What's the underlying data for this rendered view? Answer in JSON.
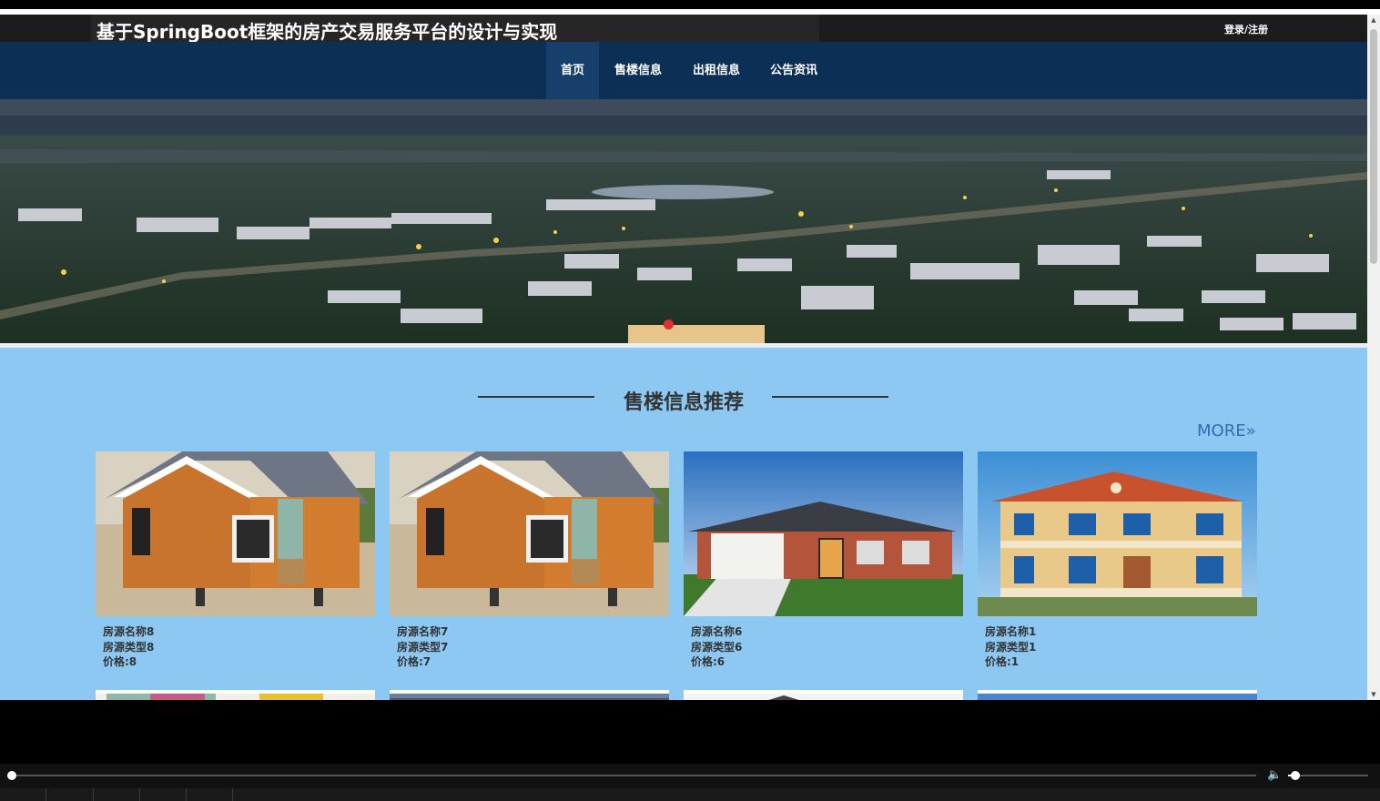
{
  "header": {
    "site_title": "基于SpringBoot框架的房产交易服务平台的设计与实现",
    "login_label": "登录/注册"
  },
  "nav": {
    "items": [
      {
        "label": "首页",
        "active": true
      },
      {
        "label": "售楼信息",
        "active": false
      },
      {
        "label": "出租信息",
        "active": false
      },
      {
        "label": "公告资讯",
        "active": false
      }
    ]
  },
  "section": {
    "title": "售楼信息推荐",
    "more_label": "MORE»"
  },
  "listings": [
    {
      "name": "房源名称8",
      "type": "房源类型8",
      "price": "价格:8"
    },
    {
      "name": "房源名称7",
      "type": "房源类型7",
      "price": "价格:7"
    },
    {
      "name": "房源名称6",
      "type": "房源类型6",
      "price": "价格:6"
    },
    {
      "name": "房源名称1",
      "type": "房源类型1",
      "price": "价格:1"
    }
  ],
  "colors": {
    "nav_background": "#0b2f55",
    "nav_active": "#16406b",
    "page_background": "#8cc8f2",
    "more_link": "#2f6db5",
    "carousel_dot_active": "#e03030"
  },
  "icons": [
    "speaker-icon",
    "scroll-up-icon",
    "scroll-down-icon"
  ]
}
